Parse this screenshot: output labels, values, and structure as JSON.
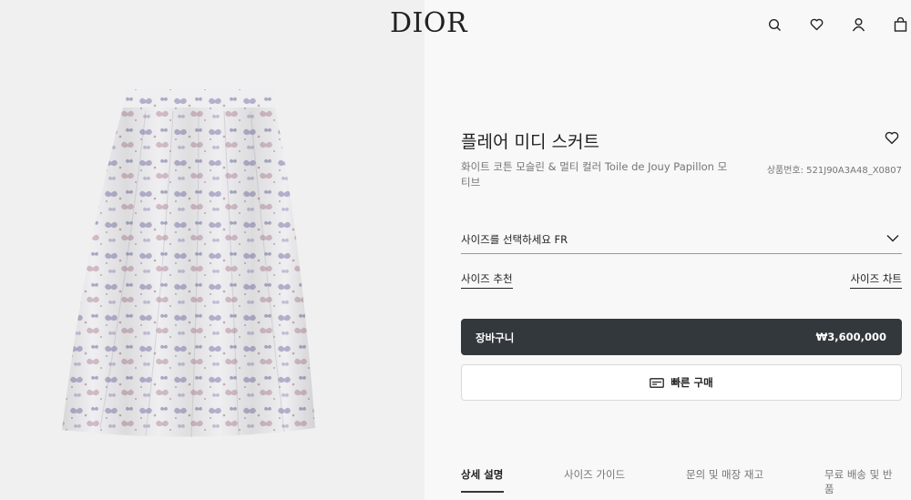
{
  "header": {
    "logo": "DIOR",
    "icons": [
      "search-icon",
      "heart-icon",
      "user-icon",
      "bag-icon"
    ]
  },
  "product": {
    "title": "플레어 미디 스커트",
    "subtitle": "화이트 코튼 모슬린 & 멀티 컬러 Toile de Jouy Papillon 모티브",
    "sku": "상품번호: 521J90A3A48_X0807",
    "image": "printed-skirt-image"
  },
  "size": {
    "select_label": "사이즈를 선택하세요 FR",
    "recommend_link": "사이즈 추천",
    "chart_link": "사이즈 차트"
  },
  "actions": {
    "cart_label": "장바구니",
    "price": "₩3,600,000",
    "quick_buy_label": "빠른 구매"
  },
  "tabs": [
    {
      "label": "상세 설명",
      "active": true
    },
    {
      "label": "사이즈 가이드",
      "active": false
    },
    {
      "label": "문의 및 매장 재고",
      "active": false
    },
    {
      "label": "무료 배송 및 반품",
      "active": false
    }
  ],
  "colors": {
    "primary_button": "#33383c",
    "background_right": "#f8f8f8",
    "background_left": "#f0f0f0"
  }
}
